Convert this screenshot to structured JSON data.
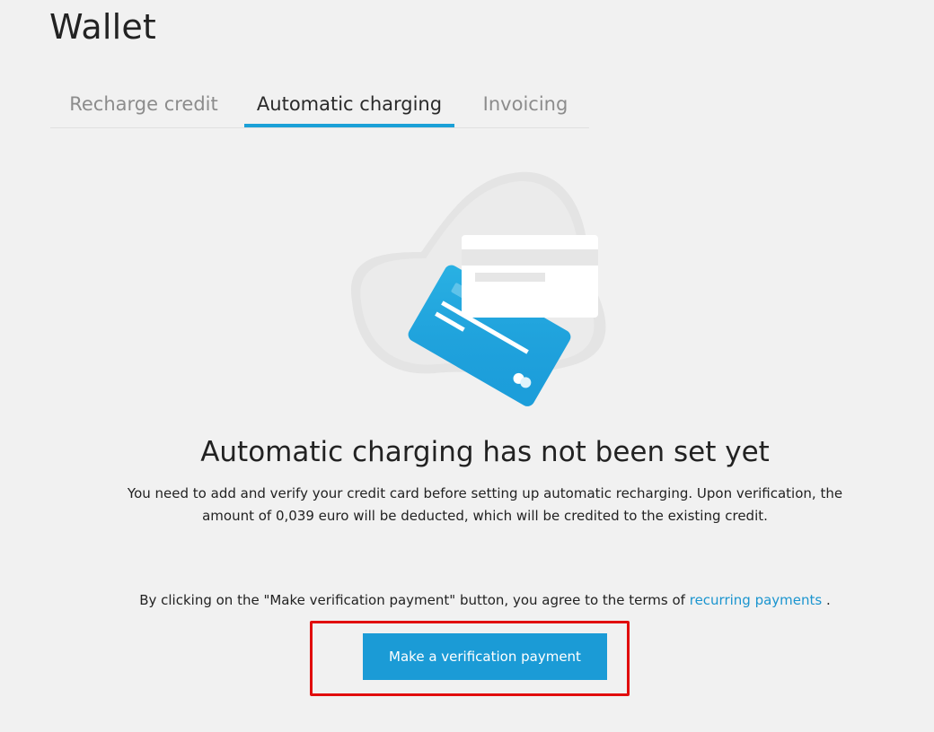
{
  "page": {
    "title": "Wallet"
  },
  "tabs": [
    {
      "label": "Recharge credit",
      "active": false
    },
    {
      "label": "Automatic charging",
      "active": true
    },
    {
      "label": "Invoicing",
      "active": false
    }
  ],
  "empty_state": {
    "illustration_icon": "credit-cards-icon",
    "headline": "Automatic charging has not been set yet",
    "description_line1": "You need to add and verify your credit card before setting up automatic recharging. Upon verification, the",
    "description_line2": "amount of 0,039 euro will be deducted, which will be credited to the existing credit.",
    "terms_prefix": "By clicking on the \"Make verification payment\" button, you agree to the terms of",
    "terms_link": "recurring payments",
    "terms_suffix": ".",
    "button_label": "Make a verification payment"
  },
  "colors": {
    "accent": "#1b9bd6",
    "link": "#1b95cf",
    "highlight_border": "#e10d0d",
    "background": "#f1f1f1"
  }
}
